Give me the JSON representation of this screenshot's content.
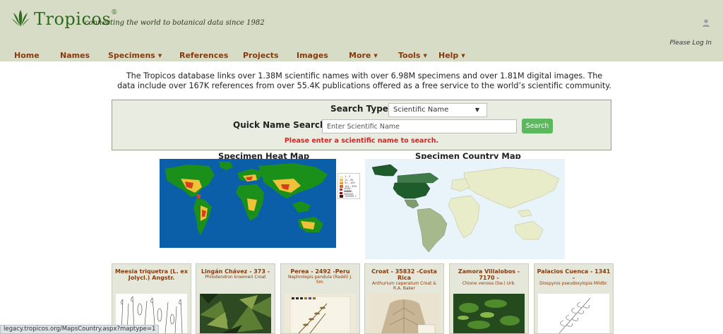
{
  "header": {
    "logo_text": "Tropicos",
    "logo_reg": "®",
    "tagline": "connecting the world to botanical data since 1982",
    "login_label": "Please Log In"
  },
  "nav": {
    "items": [
      {
        "label": "Home",
        "dropdown": false
      },
      {
        "label": "Names",
        "dropdown": false
      },
      {
        "label": "Specimens",
        "dropdown": true
      },
      {
        "label": "References",
        "dropdown": false
      },
      {
        "label": "Projects",
        "dropdown": false
      },
      {
        "label": "Images",
        "dropdown": false
      },
      {
        "label": "More",
        "dropdown": true
      },
      {
        "label": "Tools",
        "dropdown": true
      },
      {
        "label": "Help",
        "dropdown": true
      }
    ],
    "caret": "▼"
  },
  "intro": "The Tropicos database links over 1.38M scientific names with over 6.98M specimens and over 1.81M digital images. The data include over 167K references from over 55.4K publications offered as a free service to the world’s scientific community.",
  "search": {
    "type_label": "Search Type",
    "type_value": "Scientific Name",
    "quick_label": "Quick Name Search",
    "input_placeholder": "Enter Scientific Name",
    "input_value": "",
    "button_label": "Search",
    "error": "Please enter a scientific name to search."
  },
  "maps": {
    "heat_title": "Specimen Heat Map",
    "country_title": "Specimen Country Map",
    "heat_legend": [
      {
        "label": "1 - 3",
        "color": "#f5f08a"
      },
      {
        "label": "11 - 50",
        "color": "#f3c94a"
      },
      {
        "label": "51 - 100",
        "color": "#f09a2a"
      },
      {
        "label": "101 - 500",
        "color": "#e0661c"
      },
      {
        "label": "1000 - 10000",
        "color": "#c8321a"
      },
      {
        "label": "10001 - 100000",
        "color": "#8a1a12"
      },
      {
        "label": "100000 +",
        "color": "#5a0c08"
      }
    ]
  },
  "cards": [
    {
      "title": "Meesia triquetra (L. ex Jolycl.) Angstr.",
      "subtitle": ""
    },
    {
      "title": "Lingán Chávez - 373 -",
      "subtitle": "Philodendron kroemeri Croat"
    },
    {
      "title": "Perea - 2492 -Peru",
      "subtitle": "Nephrolepis pendula (Raddi) J. Sm."
    },
    {
      "title": "Croat - 35832 -Costa Rica",
      "subtitle": "Anthurium caperatum Croat & R.A. Baker"
    },
    {
      "title": "Zamora Villalobos - 7170 -",
      "subtitle": "Chione venosa (Sw.) Urb."
    },
    {
      "title": "Palacios Cuenca - 1341 -",
      "subtitle": "Diospyros pseudoxylopia Mildbr."
    }
  ],
  "status_bar": "legacy.tropicos.org/MapsCountry.aspx?maptype=1",
  "colors": {
    "header_bg": "#d7dcc7",
    "nav_text": "#8a3a0a",
    "error": "#e02020",
    "search_button": "#5cb85c",
    "ocean": "#0b5fa8",
    "land_green": "#1a8f1a"
  },
  "icons": {
    "logo": "fern-logo-icon",
    "user": "user-icon",
    "select": "chevron-down-icon"
  }
}
